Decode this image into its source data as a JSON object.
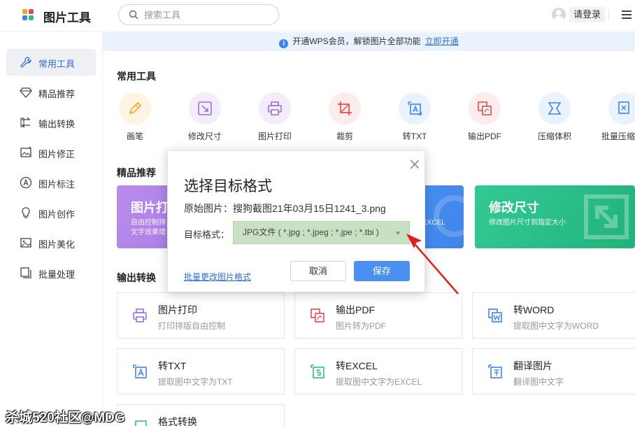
{
  "header": {
    "app_title": "图片工具",
    "search_placeholder": "搜索工具",
    "login_label": "请登录"
  },
  "sidebar": {
    "items": [
      {
        "label": "常用工具",
        "icon": "wrench-icon",
        "active": true
      },
      {
        "label": "精品推荐",
        "icon": "diamond-icon"
      },
      {
        "label": "输出转换",
        "icon": "convert-icon"
      },
      {
        "label": "图片修正",
        "icon": "image-fix-icon"
      },
      {
        "label": "图片标注",
        "icon": "annotation-icon"
      },
      {
        "label": "图片创作",
        "icon": "bulb-icon"
      },
      {
        "label": "图片美化",
        "icon": "image-icon"
      },
      {
        "label": "批量处理",
        "icon": "batch-icon"
      }
    ]
  },
  "banner": {
    "text": "开通WPS会员，解锁图片全部功能",
    "link": "立即开通"
  },
  "common_tools": {
    "title": "常用工具",
    "items": [
      {
        "label": "画笔",
        "icon": "pen-icon",
        "color": "#f5a623"
      },
      {
        "label": "修改尺寸",
        "icon": "resize-icon",
        "color": "#9b6fdc"
      },
      {
        "label": "图片打印",
        "icon": "printer-icon",
        "color": "#9b6fdc"
      },
      {
        "label": "裁剪",
        "icon": "crop-icon",
        "color": "#e84b4b"
      },
      {
        "label": "转TXT",
        "icon": "text-icon",
        "color": "#3f84ea"
      },
      {
        "label": "输出PDF",
        "icon": "pdf-icon",
        "color": "#e84b4b"
      },
      {
        "label": "压缩体积",
        "icon": "compress-icon",
        "color": "#3f84ea"
      },
      {
        "label": "批量压缩",
        "icon": "batch-compress-icon",
        "color": "#3f84ea"
      }
    ]
  },
  "featured": {
    "title": "精品推荐",
    "cards": [
      {
        "title": "图片打",
        "subtitle_line1": "自由控制排",
        "subtitle_line2": "文字效果增",
        "color": "#a97ae6"
      },
      {
        "title": "",
        "subtitle_line1": "EXCEL",
        "color": "#4a90f0"
      },
      {
        "title": "修改尺寸",
        "subtitle_line1": "修改图片尺寸到指定大小",
        "color": "#2dc08a"
      }
    ]
  },
  "conversion": {
    "title": "输出转换",
    "cards": [
      {
        "title": "图片打印",
        "subtitle": "打印排版自由控制",
        "icon": "printer-icon",
        "color": "#9b6fdc"
      },
      {
        "title": "输出PDF",
        "subtitle": "图片转为PDF",
        "icon": "pdf-icon",
        "color": "#e84b4b"
      },
      {
        "title": "转WORD",
        "subtitle": "提取图中文字为WORD",
        "icon": "word-icon",
        "color": "#3f84ea"
      },
      {
        "title": "转TXT",
        "subtitle": "提取图中文字为TXT",
        "icon": "text-icon",
        "color": "#3f84ea"
      },
      {
        "title": "转EXCEL",
        "subtitle": "提取图中文字为EXCEL",
        "icon": "excel-icon",
        "color": "#2dc08a"
      },
      {
        "title": "翻译图片",
        "subtitle": "翻译图中文字",
        "icon": "translate-icon",
        "color": "#3f84ea"
      },
      {
        "title": "格式转换",
        "subtitle": "",
        "icon": "format-icon",
        "color": "#2dc08a"
      }
    ]
  },
  "dialog": {
    "title": "选择目标格式",
    "source_label": "原始图片：搜狗截图21年03月15日1241_3.png",
    "format_label": "目标格式：",
    "format_value": "JPG文件 ( *.jpg ; *.jpeg ; *.jpe ; *.tbi )",
    "batch_link": "批量更改图片格式",
    "cancel_label": "取消",
    "save_label": "保存"
  },
  "watermark": "杀城520社区@MDG",
  "colors": {
    "accent": "#2f6fd6",
    "primary_button": "#4a90f0",
    "select_highlight": "#c9e1c2",
    "arrow": "#e02020"
  }
}
